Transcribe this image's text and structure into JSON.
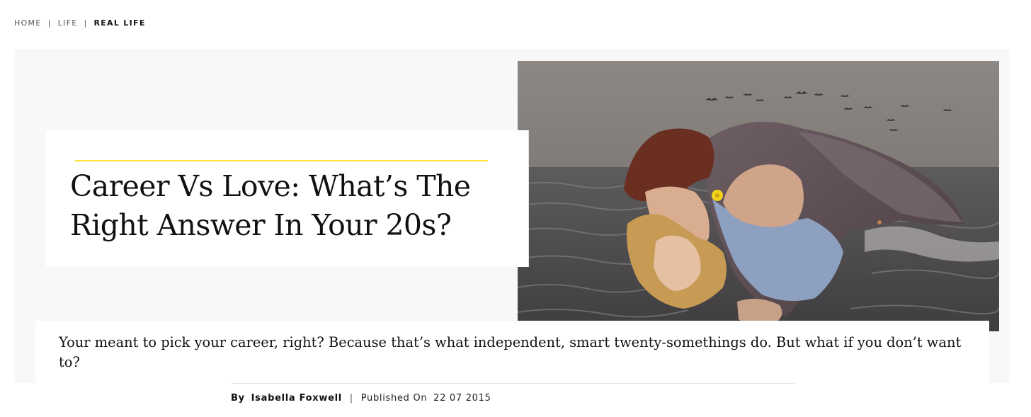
{
  "breadcrumb": {
    "items": [
      {
        "label": "HOME"
      },
      {
        "label": "LIFE"
      },
      {
        "label": "REAL LIFE"
      }
    ],
    "separator": "|"
  },
  "article": {
    "title": "Career Vs Love: What’s The Right Answer In Your 20s?",
    "standfirst": "Your meant to pick your career, right? Because that’s what independent, smart twenty-somethings do. But what if you don’t want to?",
    "byline": {
      "by_label": "By",
      "author": "Isabella Foxwell",
      "separator": "|",
      "published_label": "Published On",
      "published_date": "22 07 2015"
    }
  },
  "hero_image": {
    "subject": "collage of a couple kissing in front of a grey sea with birds",
    "accent_flower": "#f2d21b"
  },
  "colors": {
    "accent_rule": "#ffe135",
    "hero_background": "#f8f8f8",
    "text": "#111111"
  }
}
